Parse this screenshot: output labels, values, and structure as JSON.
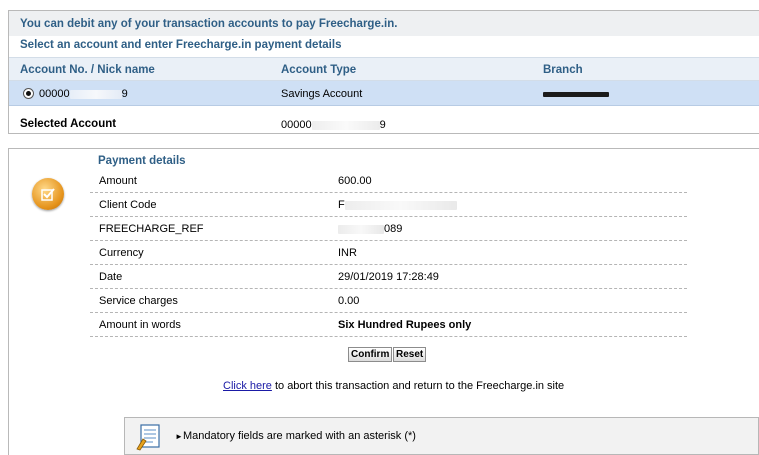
{
  "banner": {
    "title": "You can debit any of your transaction accounts to pay Freecharge.in.",
    "instruction": "Select an account and enter Freecharge.in payment details"
  },
  "accounts_table": {
    "headers": [
      "Account No. / Nick name",
      "Account Type",
      "Branch"
    ],
    "rows": [
      {
        "account_prefix": "00000",
        "account_suffix": "9",
        "type": "Savings Account",
        "selected": true
      }
    ]
  },
  "selected_account": {
    "label": "Selected Account",
    "value_prefix": "00000",
    "value_suffix": "9"
  },
  "payment": {
    "title": "Payment details",
    "rows": [
      {
        "label": "Amount",
        "value": "600.00",
        "bold": false
      },
      {
        "label": "Client Code",
        "value": "F",
        "bold": false,
        "masked": true
      },
      {
        "label": "FREECHARGE_REF",
        "value": "089",
        "bold": false,
        "masked": true
      },
      {
        "label": "Currency",
        "value": "INR",
        "bold": false
      },
      {
        "label": "Date",
        "value": "29/01/2019 17:28:49",
        "bold": false
      },
      {
        "label": "Service charges",
        "value": "0.00",
        "bold": false
      },
      {
        "label": "Amount in words",
        "value": "Six Hundred Rupees only",
        "bold": true
      }
    ]
  },
  "buttons": {
    "confirm": "Confirm",
    "reset": "Reset"
  },
  "abort": {
    "link_text": "Click here",
    "rest": " to abort this transaction and return to the Freecharge.in site"
  },
  "note": {
    "text": "Mandatory fields are marked with an asterisk (*)"
  },
  "colors": {
    "heading_blue": "#2f5f86",
    "selected_row": "#cfe0f5",
    "link": "#1a1aa6",
    "icon_orange": "#e5931b"
  },
  "icons": [
    "radio-selected-icon",
    "checkbox-badge-icon",
    "notepad-icon",
    "bullet-arrow-icon"
  ]
}
